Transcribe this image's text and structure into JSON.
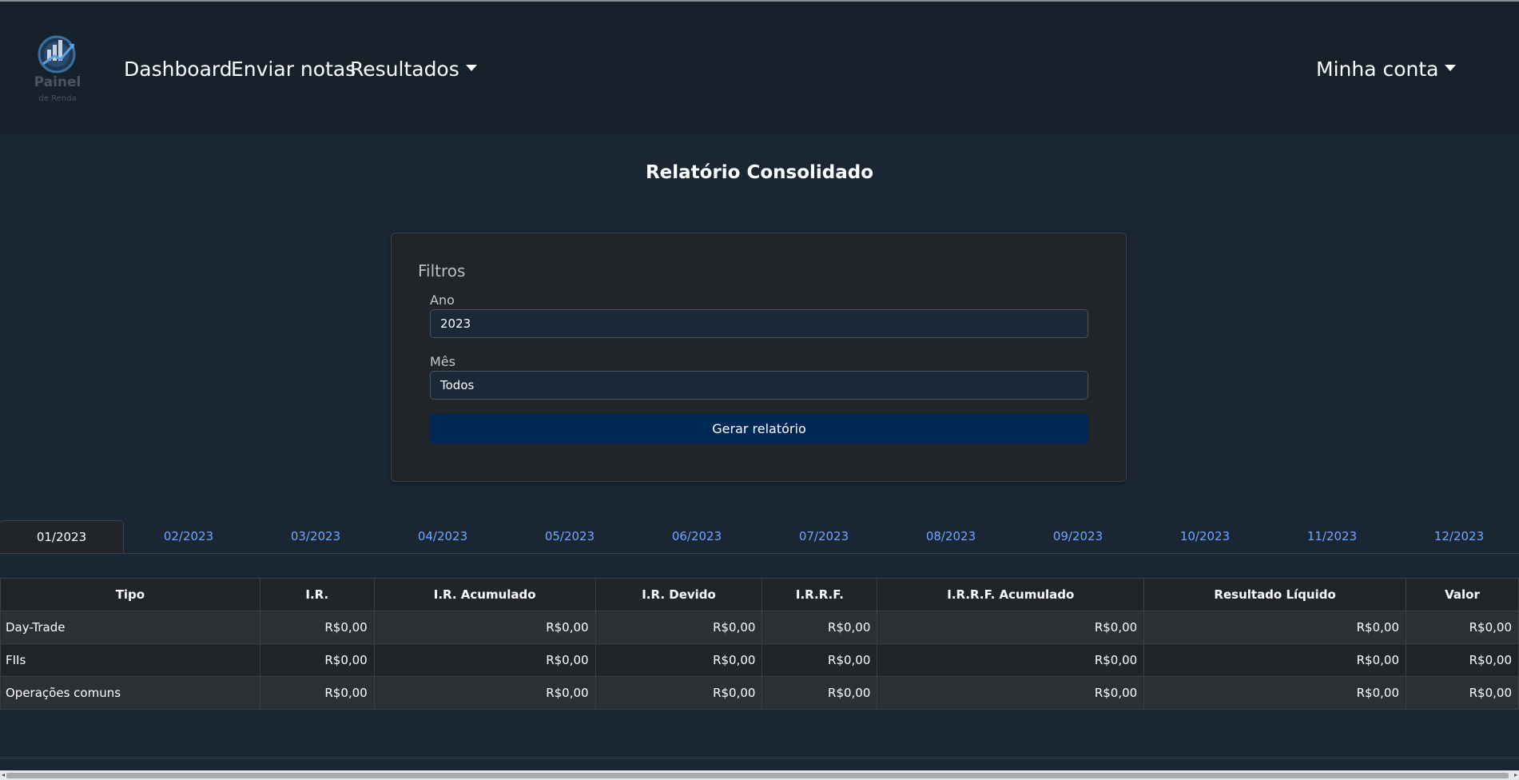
{
  "nav": {
    "logo_text": "Painel",
    "logo_subtext": "de Renda",
    "links": [
      "Dashboard",
      "Enviar notas",
      "Resultados"
    ],
    "account": "Minha conta"
  },
  "page": {
    "title": "Relatório Consolidado"
  },
  "filters": {
    "title": "Filtros",
    "year_label": "Ano",
    "year_value": "2023",
    "month_label": "Mês",
    "month_value": "Todos",
    "button": "Gerar relatório"
  },
  "tabs": [
    "01/2023",
    "02/2023",
    "03/2023",
    "04/2023",
    "05/2023",
    "06/2023",
    "07/2023",
    "08/2023",
    "09/2023",
    "10/2023",
    "11/2023",
    "12/2023"
  ],
  "active_tab": "01/2023",
  "table": {
    "headers": [
      "Tipo",
      "I.R.",
      "I.R. Acumulado",
      "I.R. Devido",
      "I.R.R.F.",
      "I.R.R.F. Acumulado",
      "Resultado Líquido",
      "Valor"
    ],
    "rows": [
      [
        "Day-Trade",
        "R$0,00",
        "R$0,00",
        "R$0,00",
        "R$0,00",
        "R$0,00",
        "R$0,00",
        "R$0,00"
      ],
      [
        "FIIs",
        "R$0,00",
        "R$0,00",
        "R$0,00",
        "R$0,00",
        "R$0,00",
        "R$0,00",
        "R$0,00"
      ],
      [
        "Operações comuns",
        "R$0,00",
        "R$0,00",
        "R$0,00",
        "R$0,00",
        "R$0,00",
        "R$0,00",
        "R$0,00"
      ]
    ]
  },
  "colors": {
    "background": "#1a2634",
    "navbar": "#17212c",
    "card": "#212529",
    "link": "#6ea8fe",
    "button": "#002855"
  }
}
